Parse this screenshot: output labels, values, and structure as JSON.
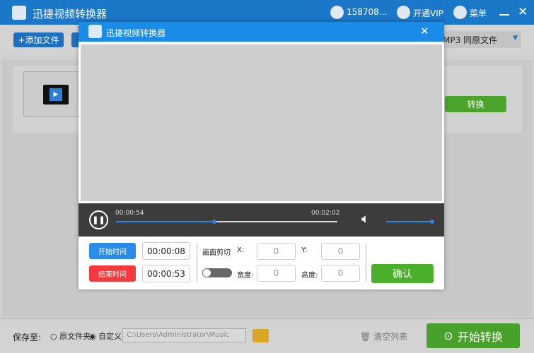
{
  "app": {
    "title": "迅捷视频转换器",
    "user": "158708...",
    "vip": "开通VIP",
    "menu": "菜单"
  },
  "toolbar": {
    "add_file": "添加文件",
    "format": "MP3",
    "output": "同原文件"
  },
  "file_row": {
    "convert": "转换"
  },
  "dialog": {
    "title": "迅捷视频转换器",
    "player": {
      "current_time": "00:00:54",
      "total_time": "00:02:02",
      "progress": 0.443,
      "volume": 1.0
    },
    "start_time_label": "开始时间",
    "start_time": "00:00:08",
    "end_time_label": "结束时间",
    "end_time": "00:00:53",
    "crop_label": "画面剪切",
    "crop_enabled": false,
    "x_label": "X:",
    "x": "0",
    "y_label": "Y:",
    "y": "0",
    "width_label": "宽度:",
    "width": "0",
    "height_label": "高度:",
    "height": "0",
    "confirm": "确认"
  },
  "bottom": {
    "save_to": "保存至:",
    "opt_original": "原文件夹",
    "opt_custom": "自定义",
    "selected": "custom",
    "path": "C:\\Users\\Administrator\\Music",
    "clear": "清空列表",
    "start": "开始转换"
  },
  "colors": {
    "blue": "#1b78c8",
    "dialog_blue": "#1a8ce8",
    "green": "#4aa52a",
    "red": "#f5393c"
  }
}
